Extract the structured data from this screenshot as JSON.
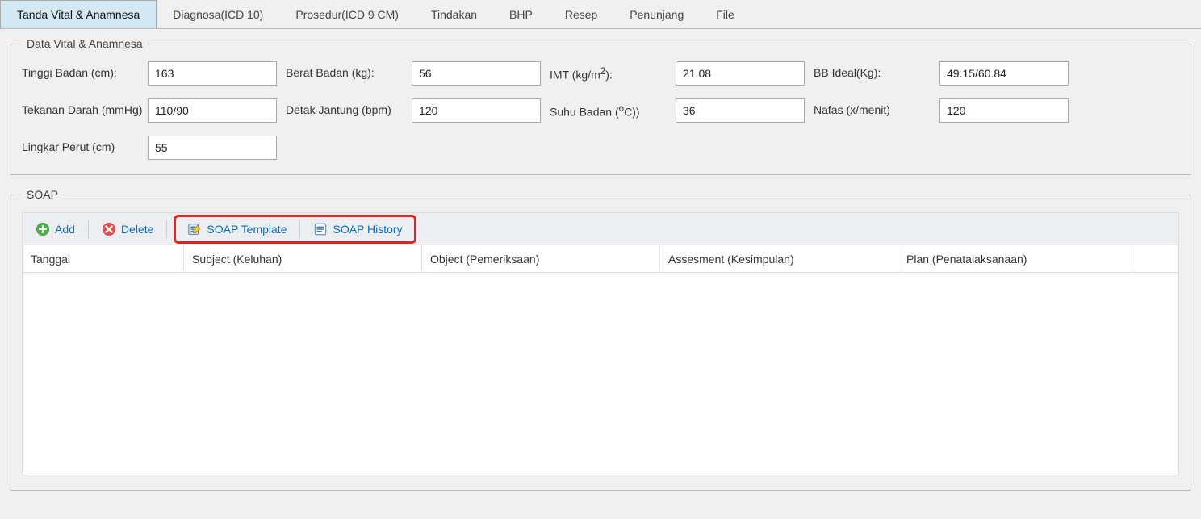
{
  "tabs": {
    "vital": "Tanda Vital & Anamnesa",
    "diag": "Diagnosa(ICD 10)",
    "pros": "Prosedur(ICD 9 CM)",
    "tindakan": "Tindakan",
    "bhp": "BHP",
    "resep": "Resep",
    "penunjang": "Penunjang",
    "file": "File"
  },
  "vitals": {
    "legend": "Data Vital & Anamnesa",
    "tinggi_label": "Tinggi Badan (cm):",
    "tinggi": "163",
    "berat_label": "Berat Badan (kg):",
    "berat": "56",
    "imt_label_pre": "IMT (kg/m",
    "imt_label_post": "):",
    "imt": "21.08",
    "bbideal_label": "BB Ideal(Kg):",
    "bbideal": "49.15/60.84",
    "tekanan_label": "Tekanan Darah (mmHg)",
    "tekanan": "110/90",
    "detak_label": "Detak Jantung (bpm)",
    "detak": "120",
    "suhu_label_pre": "Suhu Badan (",
    "suhu_label_post": "C))",
    "suhu": "36",
    "nafas_label": "Nafas (x/menit)",
    "nafas": "120",
    "lingkar_label": "Lingkar Perut (cm)",
    "lingkar": "55"
  },
  "soap": {
    "legend": "SOAP",
    "add": "Add",
    "delete": "Delete",
    "template": "SOAP Template",
    "history": "SOAP History",
    "col_tanggal": "Tanggal",
    "col_subject": "Subject (Keluhan)",
    "col_object": "Object (Pemeriksaan)",
    "col_assesment": "Assesment (Kesimpulan)",
    "col_plan": "Plan (Penatalaksanaan)"
  }
}
